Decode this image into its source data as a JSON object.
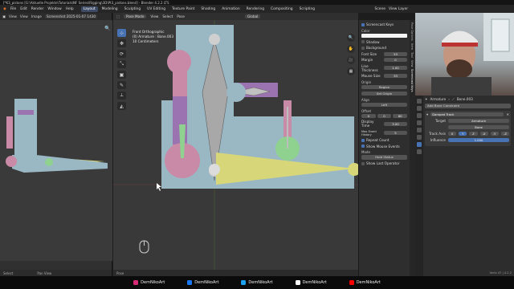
{
  "title_bar": "[*K3_pistons [G:\\Aktuelle Projekte\\Tutorials\\NF Series\\Rigging\\3D\\Pt3_pistons.blend] - Blender 4.2.2 LTS",
  "menu": [
    "File",
    "Edit",
    "Render",
    "Window",
    "Help"
  ],
  "workspaces": [
    "Layout",
    "Modeling",
    "Sculpting",
    "UV Editing",
    "Texture Paint",
    "Shading",
    "Animation",
    "Rendering",
    "Compositing",
    "Scripting"
  ],
  "active_workspace": "Layout",
  "topbar_right": [
    "Scene",
    "View Layer"
  ],
  "left_view": {
    "header": [
      "View",
      "View",
      "Image",
      "Screenshot 2025-01-07 1430"
    ],
    "footer": [
      "Select",
      "Pan View"
    ]
  },
  "viewport": {
    "mode": "Pose Mode",
    "menus": [
      "View",
      "Select",
      "Pose"
    ],
    "transform": "Global",
    "info": [
      "Front Orthographic",
      "(0) Armature : Bone.003",
      "10 Centimeters"
    ],
    "tools": [
      "⊹",
      "✥",
      "⟳",
      "⤡",
      "▣",
      "✎",
      "⟂",
      "◭"
    ],
    "nav": [
      "🔍",
      "✋",
      "🎥",
      "▦"
    ],
    "footer": "Pose",
    "colors": {
      "bg": "#393939",
      "blue_grey": "#9ab7c4",
      "pink": "#c88aa6",
      "purple": "#9a73b0",
      "green": "#8fd18f",
      "yellow": "#d7d77a"
    }
  },
  "sidebar": {
    "screencast_keys": "Screencast Keys",
    "color_label": "Color",
    "shadow": "Shadow",
    "background": "Background",
    "font_size_label": "Font Size",
    "font_size": "53",
    "margin_label": "Margin",
    "margin": "0",
    "line_thickness_label": "Line Thickness",
    "line_thickness": "1.00",
    "mouse_size_label": "Mouse Size",
    "mouse_size": "33",
    "origin_label": "Origin",
    "origin": "Region",
    "set_origin": "Set Origin",
    "align_label": "Align",
    "align": "Left",
    "offset_label": "Offset",
    "offset": [
      "0",
      "0",
      "80"
    ],
    "display_time_label": "Display Time",
    "display_time": "3.00",
    "max_history_label": "Max Event History",
    "max_history": "5",
    "repeat_count": "Repeat Count",
    "show_mouse_events": "Show Mouse Events",
    "mode_label": "Mode",
    "mode": "Hold Status",
    "show_last_operator": "Show Last Operator"
  },
  "vertical_tabs": [
    "Pose Options",
    "Item",
    "Tool",
    "View",
    "Screencast Keys",
    "Edit",
    "Animation",
    "Create"
  ],
  "properties": {
    "breadcrumb": [
      "Armature",
      "Bone.003"
    ],
    "add_constraint": "Add Bone Constraint",
    "constraint_name": "Damped Track",
    "target_label": "Target",
    "target": "Armature",
    "bone": "Bone",
    "track_axis_label": "Track Axis",
    "axes": [
      "X",
      "Y",
      "Z",
      "-X",
      "-Y",
      "-Z"
    ],
    "influence_label": "Influence",
    "influence": "1.000"
  },
  "status_version": "Verts 47 | 4.2.2",
  "socials": [
    {
      "label": "DemNikoArt",
      "color": "#d62976"
    },
    {
      "label": "DemNikoArt",
      "color": "#1877f2"
    },
    {
      "label": "DemNikoArt",
      "color": "#1da1f2"
    },
    {
      "label": "DemNikoArt",
      "color": "#ffffff"
    },
    {
      "label": "DemNikoArt",
      "color": "#ff0000"
    }
  ]
}
